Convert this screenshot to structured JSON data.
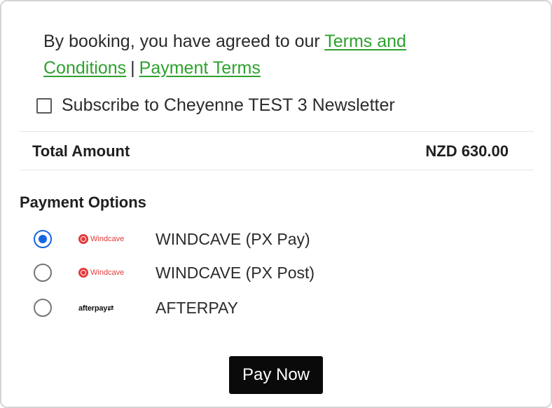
{
  "terms": {
    "prefix": "By booking, you have agreed to our",
    "terms_link": "Terms and Conditions",
    "separator": "|",
    "payment_link": "Payment Terms"
  },
  "subscribe": {
    "label": "Subscribe to Cheyenne TEST 3 Newsletter",
    "checked": false
  },
  "total": {
    "label": "Total Amount",
    "value": "NZD 630.00"
  },
  "payment": {
    "title": "Payment Options",
    "options": [
      {
        "label": "WINDCAVE (PX Pay)",
        "logo_text": "Windcave",
        "logo_icon": "windcave-logo",
        "selected": true
      },
      {
        "label": "WINDCAVE (PX Post)",
        "logo_text": "Windcave",
        "logo_icon": "windcave-logo",
        "selected": false
      },
      {
        "label": "AFTERPAY",
        "logo_text": "afterpay",
        "logo_icon": "afterpay-logo",
        "selected": false
      }
    ]
  },
  "pay_button": {
    "label": "Pay Now"
  },
  "colors": {
    "link": "#2ea12e",
    "radio_selected": "#1565e0",
    "brand_windcave": "#e23a3a",
    "button_bg": "#0a0a0a"
  }
}
